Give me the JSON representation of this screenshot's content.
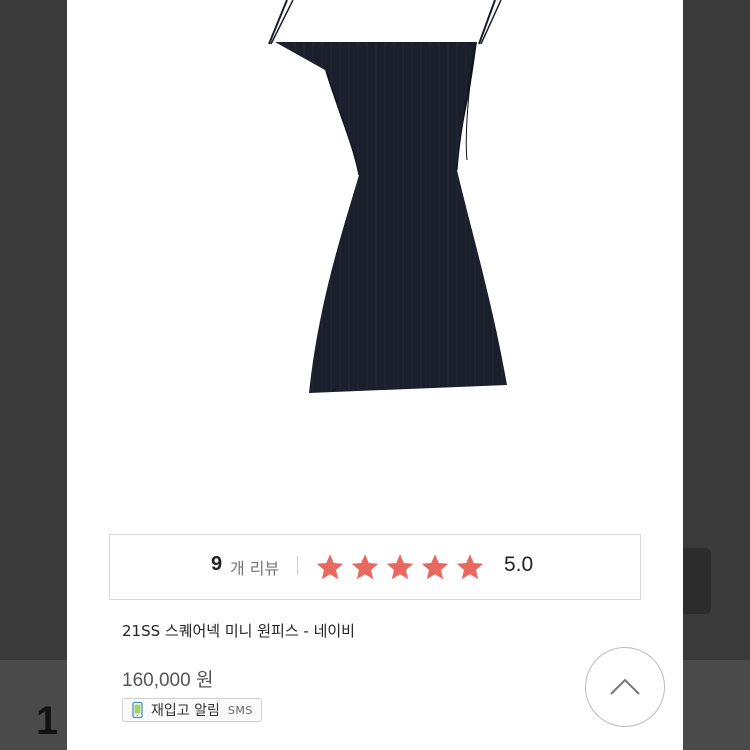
{
  "backdrop": {
    "partial_price_text": "1"
  },
  "review": {
    "count": "9",
    "label": "개 리뷰",
    "stars_filled": 5,
    "stars_total": 5,
    "rating": "5.0",
    "star_color": "#e8685f"
  },
  "product": {
    "name": "21SS 스퀘어넥 미니 원피스 - 네이비",
    "price": "160,000 원",
    "color_hex": "#1b1e2b"
  },
  "restock": {
    "label": "재입고 알림",
    "sms": "SMS",
    "icon": "phone-icon"
  },
  "scroll_top": {
    "icon": "chevron-up-icon"
  }
}
